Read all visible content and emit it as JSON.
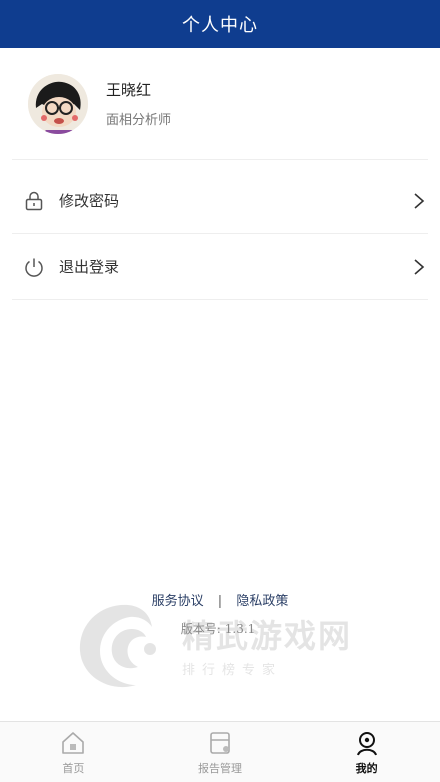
{
  "header": {
    "title": "个人中心"
  },
  "profile": {
    "name": "王晓红",
    "role": "面相分析师"
  },
  "menu": {
    "change_password": "修改密码",
    "logout": "退出登录"
  },
  "footer": {
    "service_agreement": "服务协议",
    "separator": "|",
    "privacy_policy": "隐私政策",
    "version_label": "版本号:",
    "version_value": "1.3.1"
  },
  "watermark": {
    "text": "精武游戏网",
    "subtext": "排行榜专家"
  },
  "tabbar": {
    "tabs": [
      {
        "label": "首页",
        "icon": "home-icon",
        "active": false
      },
      {
        "label": "报告管理",
        "icon": "report-icon",
        "active": false
      },
      {
        "label": "我的",
        "icon": "profile-icon",
        "active": true
      }
    ]
  },
  "colors": {
    "header_bg": "#0f3d8f",
    "link": "#2b3f66"
  }
}
